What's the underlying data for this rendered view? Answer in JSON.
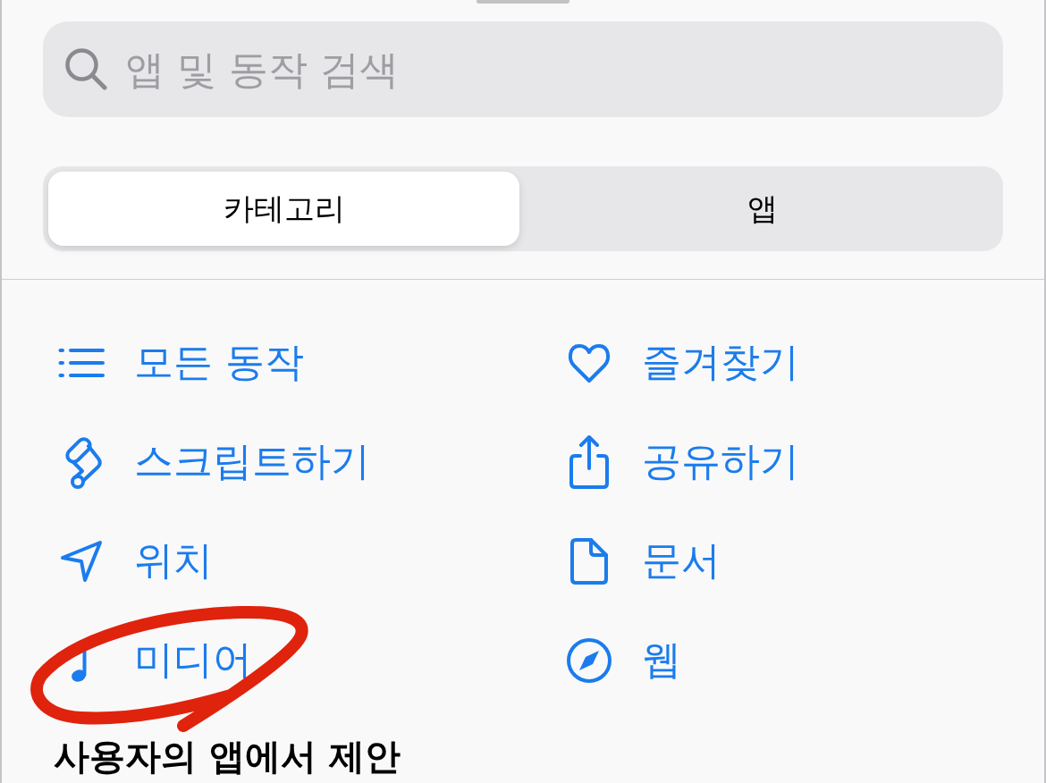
{
  "search": {
    "placeholder": "앱 및 동작 검색"
  },
  "segments": [
    {
      "label": "카테고리",
      "selected": true
    },
    {
      "label": "앱",
      "selected": false
    }
  ],
  "categories": [
    {
      "label": "모든 동작"
    },
    {
      "label": "즐겨찾기"
    },
    {
      "label": "스크립트하기"
    },
    {
      "label": "공유하기"
    },
    {
      "label": "위치"
    },
    {
      "label": "문서"
    },
    {
      "label": "미디어"
    },
    {
      "label": "웹"
    }
  ],
  "section_title": "사용자의 앱에서 제안"
}
